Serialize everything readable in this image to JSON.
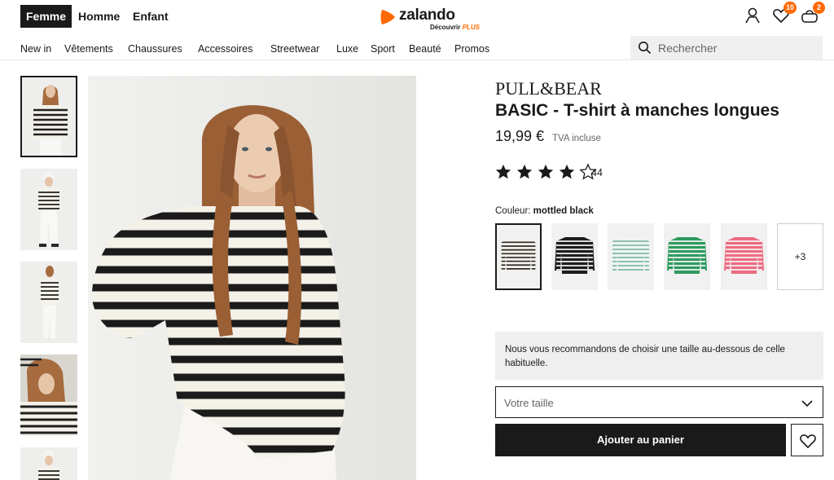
{
  "header": {
    "gender_tabs": [
      {
        "label": "Femme",
        "active": true
      },
      {
        "label": "Homme",
        "active": false
      },
      {
        "label": "Enfant",
        "active": false
      }
    ],
    "logo": {
      "word": "zalando",
      "sub_text": "Découvrir",
      "sub_plus": "PLUS"
    },
    "icons": {
      "account": "user-icon",
      "wishlist": "heart-icon",
      "bag": "bag-icon"
    },
    "wishlist_count": "10",
    "bag_count": "2"
  },
  "nav": {
    "items": [
      "New in",
      "Vêtements",
      "Chaussures",
      "Accessoires",
      "Streetwear",
      "Luxe",
      "Sport",
      "Beauté",
      "Promos"
    ],
    "search_placeholder": "Rechercher"
  },
  "product": {
    "brand": "PULL&BEAR",
    "title": "BASIC - T-shirt à manches longues",
    "price": "19,99 €",
    "vat": "TVA incluse",
    "rating": 4,
    "rating_max": 5,
    "review_count": "44",
    "color_label": "Couleur:",
    "color_value": "mottled black",
    "colors": [
      {
        "name": "mottled black",
        "stripe": "#2a2a2a",
        "base": "#f4f1ea",
        "selected": true
      },
      {
        "name": "black",
        "stripe": "#f0f0f0",
        "base": "#1c1c1c",
        "selected": false
      },
      {
        "name": "mint",
        "stripe": "#7fb8a8",
        "base": "#eef4f1",
        "selected": false
      },
      {
        "name": "green",
        "stripe": "#f4f4f4",
        "base": "#2e9a5e",
        "selected": false
      },
      {
        "name": "pink",
        "stripe": "#f7f2f2",
        "base": "#ec6b80",
        "selected": false
      }
    ],
    "more_colors": "+3",
    "size_advice": "Nous vous recommandons de choisir une taille au-dessous de celle habituelle.",
    "size_placeholder": "Votre taille",
    "add_to_cart": "Ajouter au panier"
  },
  "gallery": {
    "thumbnails": 5,
    "selected_index": 0
  },
  "colors": {
    "accent": "#ff6900",
    "dark": "#1a1a1a",
    "panel": "#efeff0"
  }
}
